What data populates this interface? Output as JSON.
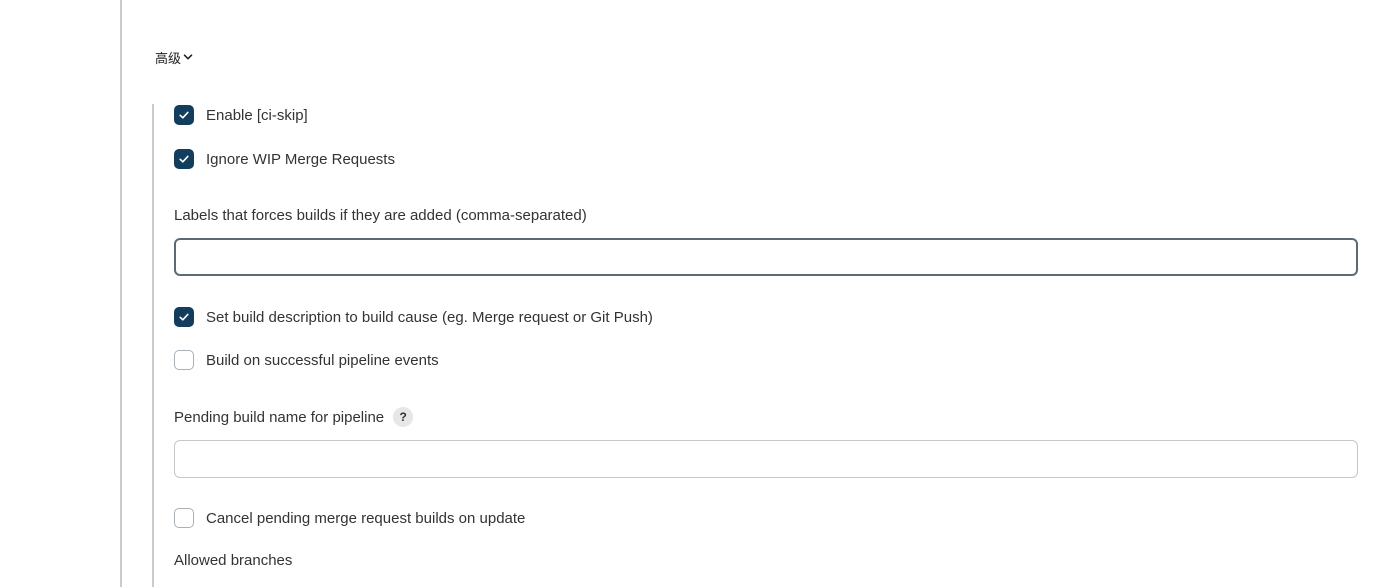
{
  "advanced": {
    "label": "高级",
    "icon": "chevron-down-icon"
  },
  "options": {
    "enable_ci_skip": {
      "label": "Enable [ci-skip]",
      "checked": true
    },
    "ignore_wip": {
      "label": "Ignore WIP Merge Requests",
      "checked": true
    },
    "set_build_description": {
      "label": "Set build description to build cause (eg. Merge request or Git Push)",
      "checked": true
    },
    "build_on_pipeline": {
      "label": "Build on successful pipeline events",
      "checked": false
    },
    "cancel_pending": {
      "label": "Cancel pending merge request builds on update",
      "checked": false
    }
  },
  "fields": {
    "labels_force_builds": {
      "label": "Labels that forces builds if they are added (comma-separated)",
      "value": ""
    },
    "pending_build_name": {
      "label": "Pending build name for pipeline",
      "help": "?",
      "value": ""
    },
    "allowed_branches": {
      "label": "Allowed branches"
    }
  },
  "colors": {
    "checkbox_checked": "#123d5c",
    "rule": "#c8ccd0"
  }
}
